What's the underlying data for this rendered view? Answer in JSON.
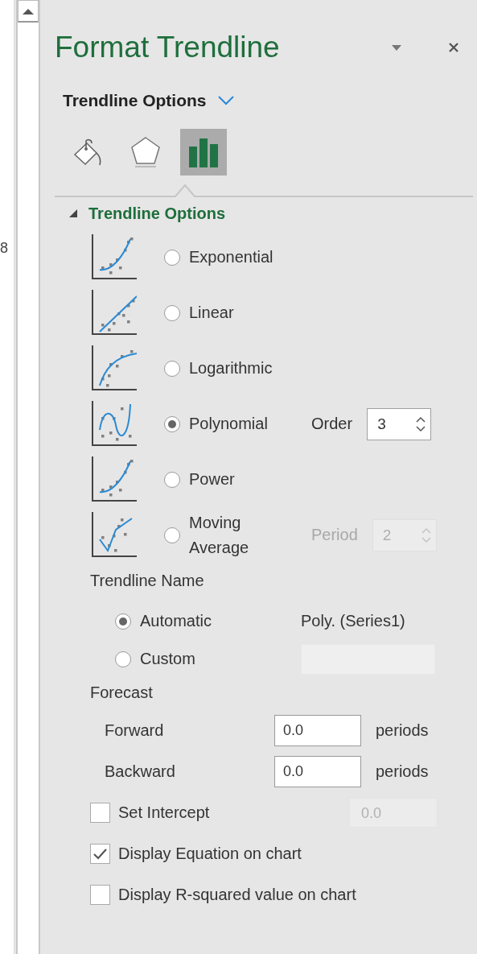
{
  "left_strip": {
    "text": "8"
  },
  "pane": {
    "title": "Format Trendline"
  },
  "category": {
    "label": "Trendline Options"
  },
  "tabs": [
    {
      "kind": "fill",
      "selected": false
    },
    {
      "kind": "effects",
      "selected": false
    },
    {
      "kind": "options",
      "selected": true
    }
  ],
  "section": {
    "title": "Trendline Options",
    "expanded": true
  },
  "types": [
    {
      "kind": "exponential",
      "label": "Exponential",
      "selected": false
    },
    {
      "kind": "linear",
      "label": "Linear",
      "selected": false
    },
    {
      "kind": "logarithmic",
      "label": "Logarithmic",
      "selected": false
    },
    {
      "kind": "polynomial",
      "label": "Polynomial",
      "selected": true,
      "param": {
        "label": "Order",
        "value": "3",
        "disabled": false
      }
    },
    {
      "kind": "power",
      "label": "Power",
      "selected": false
    },
    {
      "kind": "moving_average",
      "label": "Moving Average",
      "selected": false,
      "param": {
        "label": "Period",
        "value": "2",
        "disabled": true
      }
    }
  ],
  "trendline_name": {
    "label": "Trendline Name",
    "options": [
      {
        "label": "Automatic",
        "selected": true,
        "value": "Poly. (Series1)"
      },
      {
        "label": "Custom",
        "selected": false,
        "field_disabled": true
      }
    ]
  },
  "forecast": {
    "label": "Forecast",
    "rows": [
      {
        "label": "Forward",
        "value": "0.0",
        "unit": "periods"
      },
      {
        "label": "Backward",
        "value": "0.0",
        "unit": "periods"
      }
    ]
  },
  "checks": [
    {
      "label": "Set Intercept",
      "checked": false,
      "value": "0.0",
      "value_disabled": true
    },
    {
      "label": "Display Equation on chart",
      "checked": true
    },
    {
      "label": "Display R-squared value on chart",
      "checked": false
    }
  ]
}
